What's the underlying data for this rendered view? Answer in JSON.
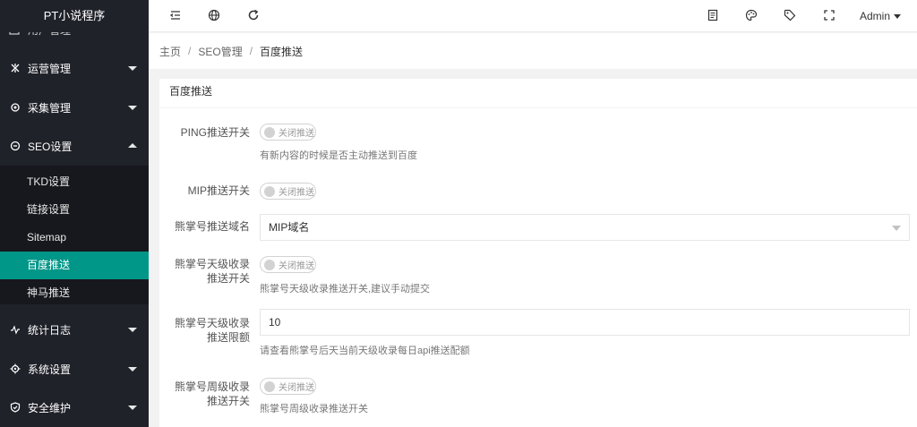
{
  "app": {
    "title": "PT小说程序"
  },
  "sidebar": {
    "cut_item": {
      "label": "用户管理"
    },
    "items": [
      {
        "label": "运营管理",
        "icon": "operations-icon"
      },
      {
        "label": "采集管理",
        "icon": "collect-icon"
      },
      {
        "label": "SEO设置",
        "icon": "seo-icon"
      },
      {
        "label": "统计日志",
        "icon": "stats-icon"
      },
      {
        "label": "系统设置",
        "icon": "gear-icon"
      },
      {
        "label": "安全维护",
        "icon": "shield-icon"
      }
    ],
    "subitems": [
      {
        "label": "TKD设置"
      },
      {
        "label": "链接设置"
      },
      {
        "label": "Sitemap"
      },
      {
        "label": "百度推送",
        "active": true
      },
      {
        "label": "神马推送"
      }
    ],
    "colors": {
      "bg": "#20222a",
      "sub_bg": "#17181d",
      "active": "#009688"
    }
  },
  "header": {
    "admin_label": "Admin",
    "icons": [
      "collapse-icon",
      "globe-icon",
      "refresh-icon",
      "notes-icon",
      "theme-icon",
      "tag-icon",
      "fullscreen-icon"
    ]
  },
  "breadcrumb": [
    "主页",
    "SEO管理",
    "百度推送"
  ],
  "card": {
    "title": "百度推送",
    "fields": {
      "ping": {
        "label": "PING推送开关",
        "switch": "关闭推送",
        "hint": "有新内容的时候是否主动推送到百度"
      },
      "mip": {
        "label": "MIP推送开关",
        "switch": "关闭推送"
      },
      "domain": {
        "label": "熊掌号推送域名",
        "value": "MIP域名"
      },
      "daily": {
        "label1": "熊掌号天级收录",
        "label2": "推送开关",
        "switch": "关闭推送",
        "hint": "熊掌号天级收录推送开关,建议手动提交"
      },
      "limit": {
        "label1": "熊掌号天级收录",
        "label2": "推送限额",
        "value": "10",
        "hint": "请查看熊掌号后天当前天级收录每日api推送配额"
      },
      "weekly": {
        "label1": "熊掌号周级收录",
        "label2": "推送开关",
        "switch": "关闭推送",
        "hint": "熊掌号周级收录推送开关"
      }
    }
  }
}
